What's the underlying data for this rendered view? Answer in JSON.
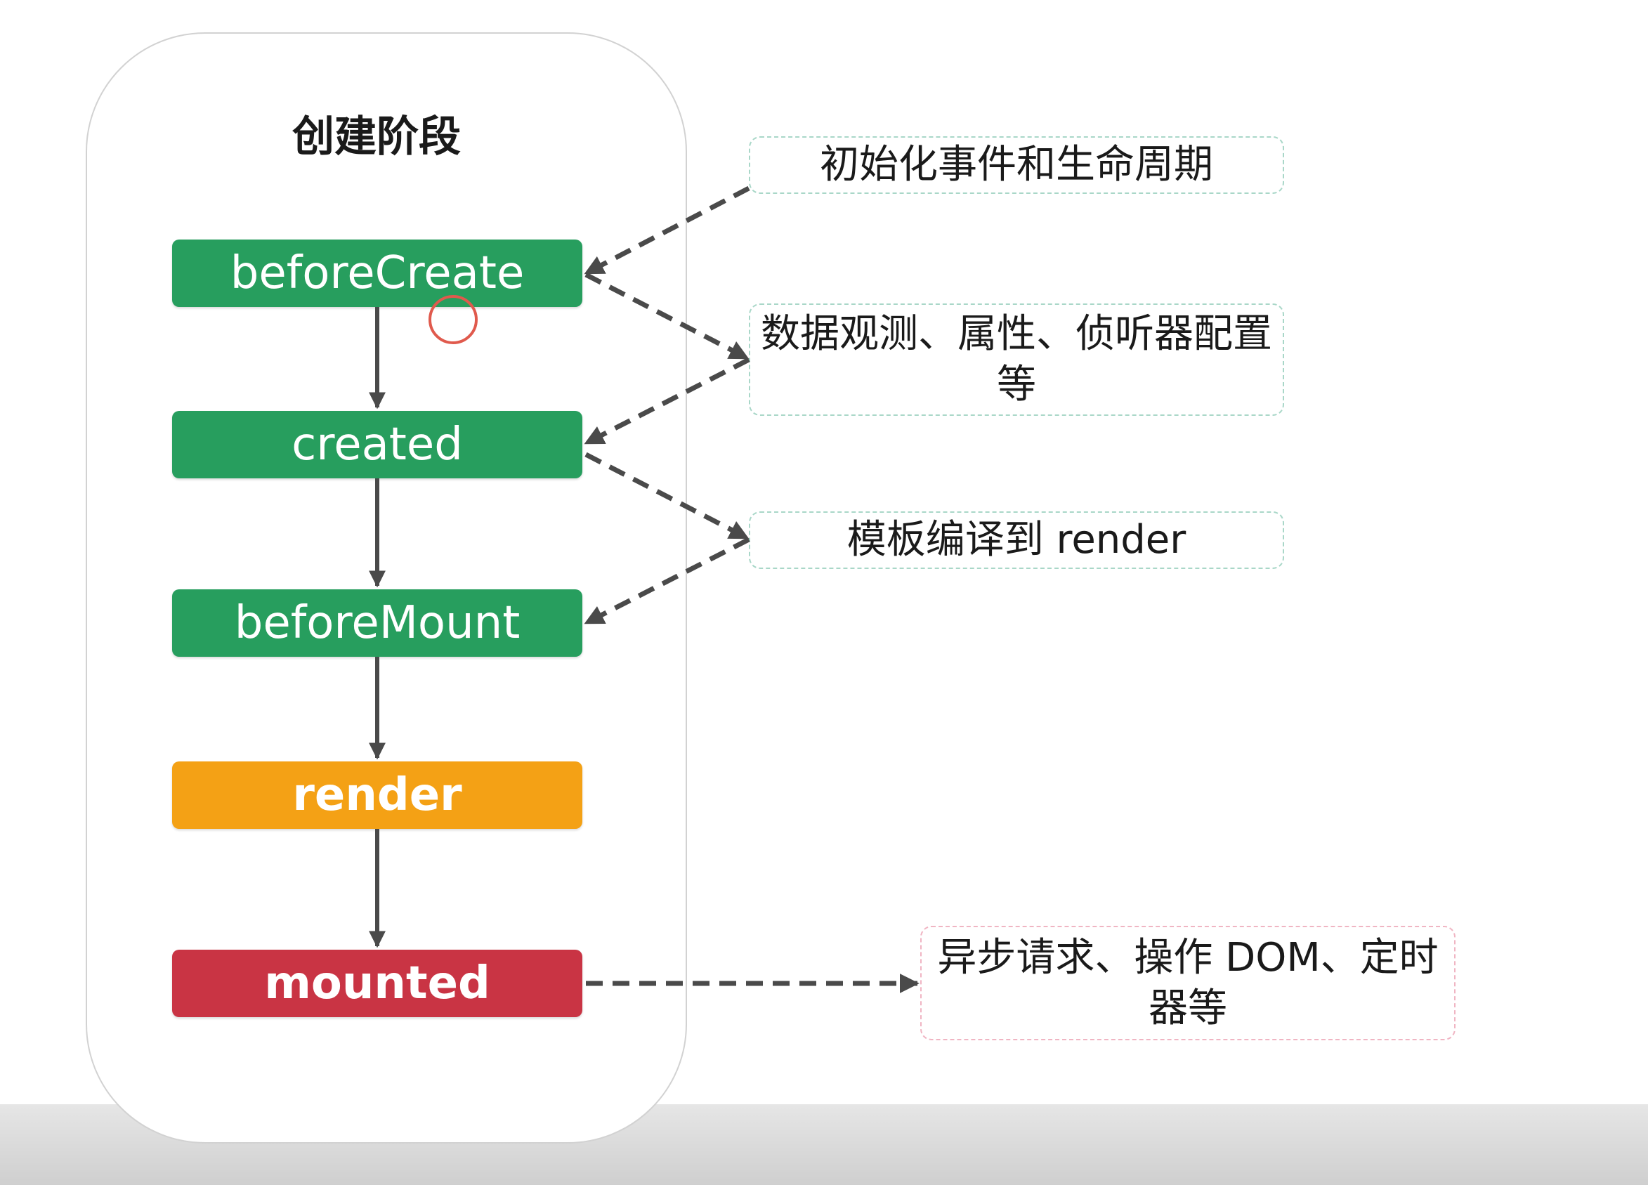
{
  "stage": {
    "title": "创建阶段"
  },
  "hooks": [
    {
      "label": "beforeCreate",
      "color": "#279e5e"
    },
    {
      "label": "created",
      "color": "#279e5e"
    },
    {
      "label": "beforeMount",
      "color": "#279e5e"
    },
    {
      "label": "render",
      "color": "#f4a115"
    },
    {
      "label": "mounted",
      "color": "#c93444"
    }
  ],
  "notes": [
    {
      "text": "初始化事件和生命周期"
    },
    {
      "text": "数据观测、属性、侦听器配置等"
    },
    {
      "text": "模板编译到 render"
    },
    {
      "text": "异步请求、操作 DOM、定时器等"
    }
  ],
  "colors": {
    "arrow": "#4a4a4a",
    "note_border_green": "#a9d7c8",
    "note_border_pink": "#f0b5c3"
  }
}
